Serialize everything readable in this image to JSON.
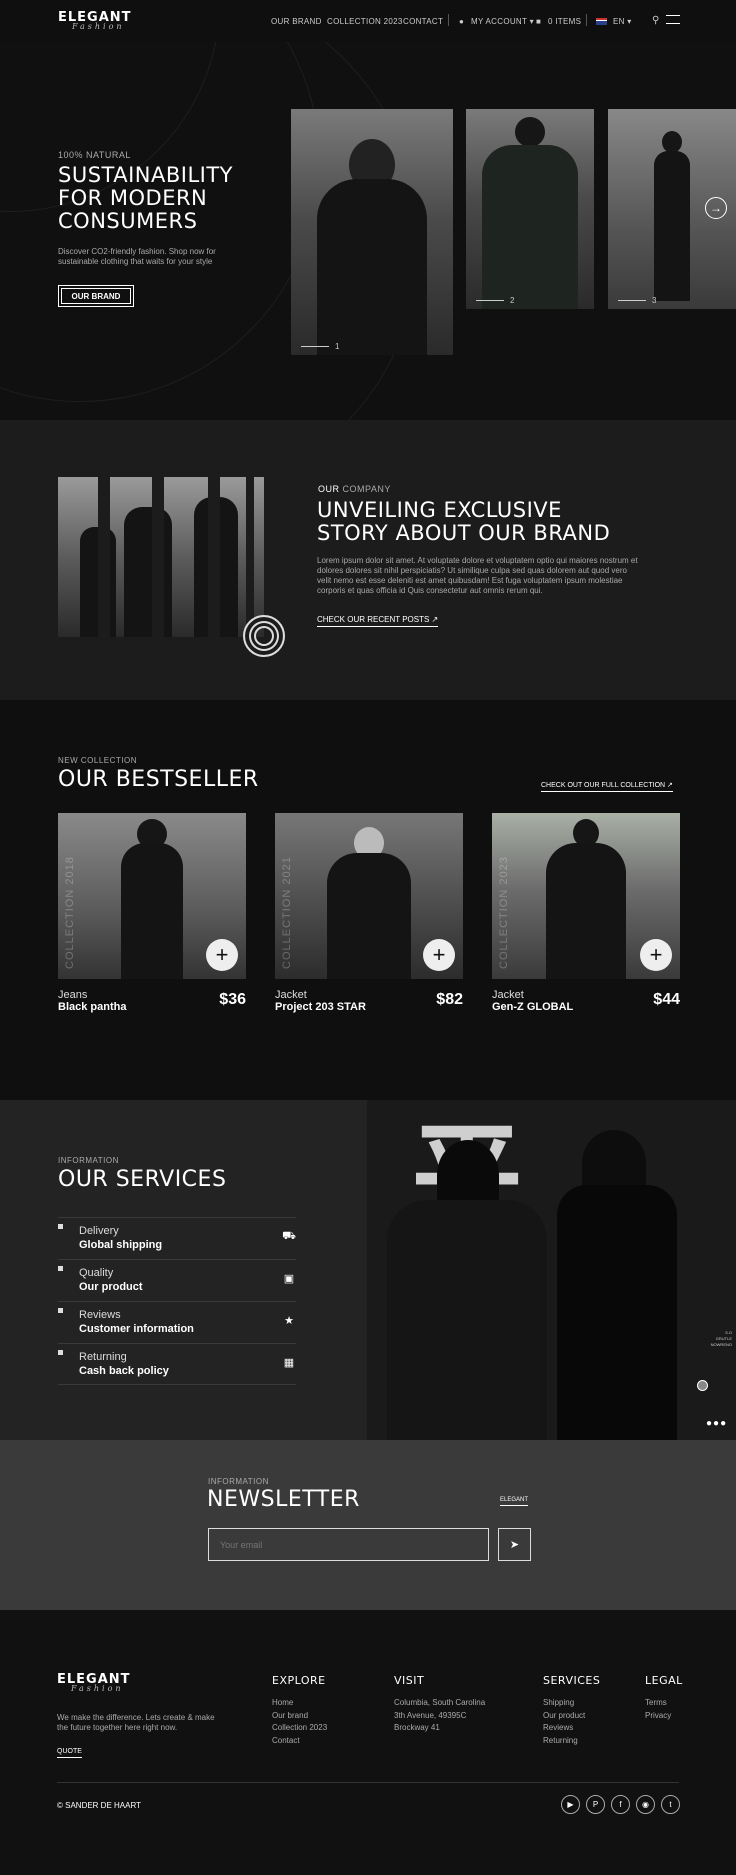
{
  "header": {
    "logo": "ELEGANT",
    "logo_sub": "Fashion",
    "nav": [
      "OUR BRAND",
      "COLLECTION 2023",
      "CONTACT"
    ],
    "account": "MY ACCOUNT",
    "cart": "0 ITEMS",
    "lang": "EN"
  },
  "hero": {
    "kicker": "100% NATURAL",
    "title_lines": [
      "SUSTAINABILITY",
      "FOR MODERN",
      "CONSUMERS"
    ],
    "desc_lines": [
      "Discover CO2-friendly fashion. Shop now for",
      "sustainable clothing that waits for your style"
    ],
    "button": "OUR BRAND",
    "slides": [
      "1",
      "2",
      "3"
    ]
  },
  "about": {
    "kicker_a": "OUR",
    "kicker_b": " COMPANY",
    "title_lines": [
      "UNVEILING EXCLUSIVE",
      "STORY ABOUT OUR BRAND"
    ],
    "body_lines": [
      "Lorem ipsum dolor sit amet. At voluptate dolore et voluptatem optio qui maiores nostrum et",
      "dolores dolores sit nihil perspiciatis? Ut similique culpa sed quas dolorem aut quod vero",
      "velit nemo est esse deleniti est amet quibusdam! Est fuga voluptatem ipsum molestiae",
      "corporis et quas officia id Quis consectetur aut omnis rerum qui."
    ],
    "link": "CHECK OUR RECENT POSTS"
  },
  "bestseller": {
    "kicker": "NEW COLLECTION",
    "title": "OUR BESTSELLER",
    "link": "CHECK OUT OUR FULL COLLECTION",
    "products": [
      {
        "vertical": "COLLECTION 2018",
        "category": "Jeans",
        "name": "Black pantha",
        "price": "$36"
      },
      {
        "vertical": "COLLECTION 2021",
        "category": "Jacket",
        "name": "Project 203 STAR",
        "price": "$82"
      },
      {
        "vertical": "COLLECTION 2023",
        "category": "Jacket",
        "name": "Gen-Z GLOBAL",
        "price": "$44"
      }
    ]
  },
  "services": {
    "kicker": "INFORMATION",
    "title": "OUR SERVICES",
    "items": [
      {
        "label": "Delivery",
        "value": "Global shipping",
        "icon": "truck-icon"
      },
      {
        "label": "Quality",
        "value": "Our product",
        "icon": "box-icon"
      },
      {
        "label": "Reviews",
        "value": "Customer information",
        "icon": "star-icon"
      },
      {
        "label": "Returning",
        "value": "Cash back policy",
        "icon": "money-icon"
      }
    ],
    "side_text": [
      "S.O",
      "GRUTLE",
      "NOWRENO"
    ]
  },
  "newsletter": {
    "kicker": "INFORMATION",
    "title": "NEWSLETTER",
    "tag": "ELEGANT",
    "placeholder": "Your email"
  },
  "footer": {
    "logo": "ELEGANT",
    "logo_sub": "Fashion",
    "tagline_lines": [
      "We make the difference. Lets create & make",
      "the future together here right now."
    ],
    "quote": "QUOTE",
    "columns": [
      {
        "title": "EXPLORE",
        "links": [
          "Home",
          "Our brand",
          "Collection 2023",
          "Contact"
        ]
      },
      {
        "title": "VISIT",
        "links": [
          "Columbia, South Carolina",
          "3th Avenue, 49395C",
          "Brockway 41"
        ]
      },
      {
        "title": "SERVICES",
        "links": [
          "Shipping",
          "Our product",
          "Reviews",
          "Returning"
        ]
      },
      {
        "title": "LEGAL",
        "links": [
          "Terms",
          "Privacy"
        ]
      }
    ],
    "copyright": "© SANDER DE HAART",
    "social": [
      "youtube-icon",
      "pinterest-icon",
      "facebook-icon",
      "instagram-icon",
      "twitter-icon"
    ]
  }
}
